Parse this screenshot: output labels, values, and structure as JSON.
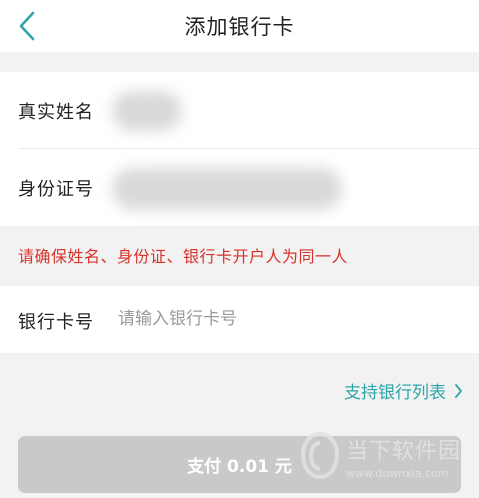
{
  "header": {
    "title": "添加银行卡"
  },
  "identity": {
    "name_label": "真实姓名",
    "id_label": "身份证号"
  },
  "warning": "请确保姓名、身份证、银行卡开户人为同一人",
  "bank_card": {
    "label": "银行卡号",
    "placeholder": "请输入银行卡号",
    "value": ""
  },
  "bank_list_link": "支持银行列表",
  "pay_button": "支付 0.01 元",
  "watermark": {
    "name": "当下软件园",
    "url": "www.downxia.com"
  },
  "colors": {
    "accent": "#2ea5a8",
    "warning": "#d8332b",
    "disabled_button": "#c9c9c9"
  }
}
